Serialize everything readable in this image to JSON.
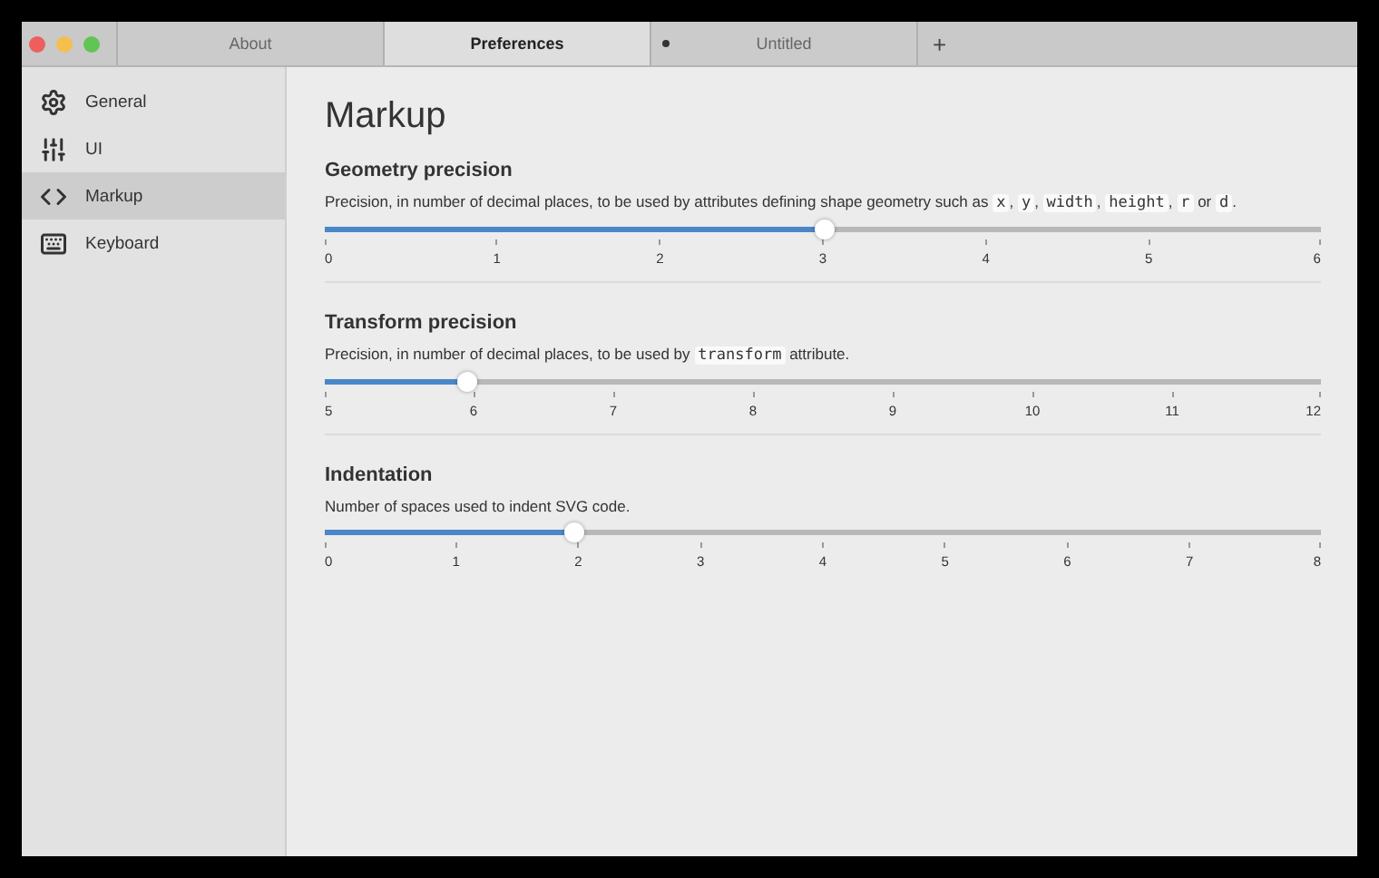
{
  "tabs": [
    {
      "label": "About",
      "selected": false,
      "modified": false
    },
    {
      "label": "Preferences",
      "selected": true,
      "modified": false
    },
    {
      "label": "Untitled",
      "selected": false,
      "modified": true
    }
  ],
  "new_tab": "+",
  "sidebar": {
    "items": [
      {
        "label": "General",
        "kind": "gear",
        "selected": false
      },
      {
        "label": "UI",
        "kind": "sliders",
        "selected": false
      },
      {
        "label": "Markup",
        "kind": "code",
        "selected": true
      },
      {
        "label": "Keyboard",
        "kind": "keyboard",
        "selected": false
      }
    ]
  },
  "page": {
    "title": "Markup",
    "sections": [
      {
        "title": "Geometry precision",
        "description": [
          {
            "kind": "text",
            "text": "Precision, in number of decimal places, to be used by attributes defining shape geometry such as "
          },
          {
            "kind": "code",
            "text": "x"
          },
          {
            "kind": "text",
            "text": ", "
          },
          {
            "kind": "code",
            "text": "y"
          },
          {
            "kind": "text",
            "text": ", "
          },
          {
            "kind": "code",
            "text": "width"
          },
          {
            "kind": "text",
            "text": ", "
          },
          {
            "kind": "code",
            "text": "height"
          },
          {
            "kind": "text",
            "text": ", "
          },
          {
            "kind": "code",
            "text": "r"
          },
          {
            "kind": "text",
            "text": " or "
          },
          {
            "kind": "code",
            "text": "d"
          },
          {
            "kind": "text",
            "text": "."
          }
        ],
        "level": 0.5,
        "ticks": [
          "0",
          "1",
          "2",
          "3",
          "4",
          "5",
          "6"
        ]
      },
      {
        "title": "Transform precision",
        "description": [
          {
            "kind": "text",
            "text": "Precision, in number of decimal places, to be used by "
          },
          {
            "kind": "code",
            "text": "transform"
          },
          {
            "kind": "text",
            "text": " attribute."
          }
        ],
        "level": 0.1429,
        "ticks": [
          "5",
          "6",
          "7",
          "8",
          "9",
          "10",
          "11",
          "12"
        ]
      },
      {
        "title": "Indentation",
        "description": [
          {
            "kind": "text",
            "text": "Number of spaces used to indent SVG code."
          }
        ],
        "level": 0.25,
        "ticks": [
          "0",
          "1",
          "2",
          "3",
          "4",
          "5",
          "6",
          "7",
          "8"
        ]
      }
    ]
  }
}
